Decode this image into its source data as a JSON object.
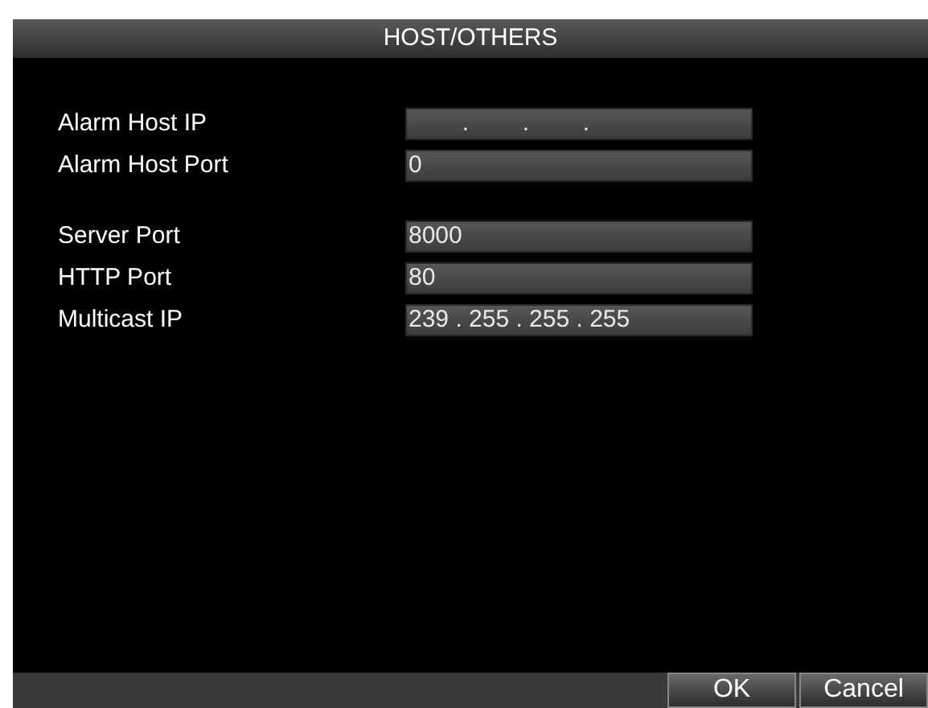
{
  "window": {
    "title": "HOST/OTHERS"
  },
  "groups": [
    {
      "fields": [
        {
          "label": "Alarm Host IP",
          "value": "        .        .        ."
        },
        {
          "label": "Alarm Host Port",
          "value": "0"
        }
      ]
    },
    {
      "fields": [
        {
          "label": "Server Port",
          "value": "8000"
        },
        {
          "label": "HTTP Port",
          "value": "80"
        },
        {
          "label": "Multicast IP",
          "value": "239 . 255 . 255 . 255"
        }
      ]
    }
  ],
  "buttons": [
    "OK",
    "Cancel"
  ]
}
